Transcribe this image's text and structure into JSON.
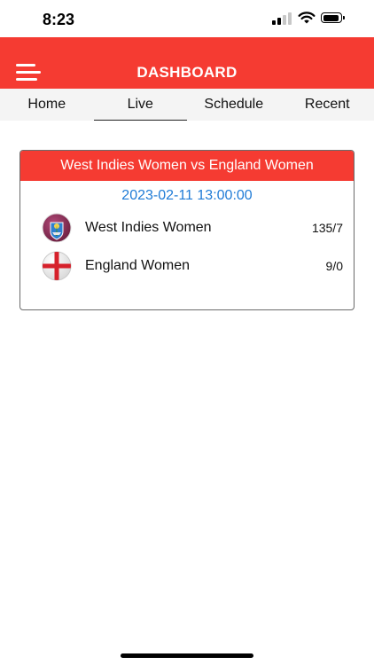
{
  "status_bar": {
    "time": "8:23",
    "icons": [
      "signal-icon",
      "wifi-icon",
      "battery-icon"
    ]
  },
  "header": {
    "title": "DASHBOARD",
    "menu_icon": "hamburger-menu-icon",
    "background": "#f53b32"
  },
  "tabs": [
    {
      "label": "Home",
      "active": false
    },
    {
      "label": "Live",
      "active": true
    },
    {
      "label": "Schedule",
      "active": false
    },
    {
      "label": "Recent",
      "active": false
    }
  ],
  "match": {
    "title": "West Indies Women vs England Women",
    "datetime": "2023-02-11 13:00:00",
    "date_color": "#1f7bd6",
    "teams": [
      {
        "name": "West Indies Women",
        "score": "135/7",
        "logo": "west-indies-flag-icon"
      },
      {
        "name": "England Women",
        "score": "9/0",
        "logo": "england-flag-icon"
      }
    ]
  }
}
